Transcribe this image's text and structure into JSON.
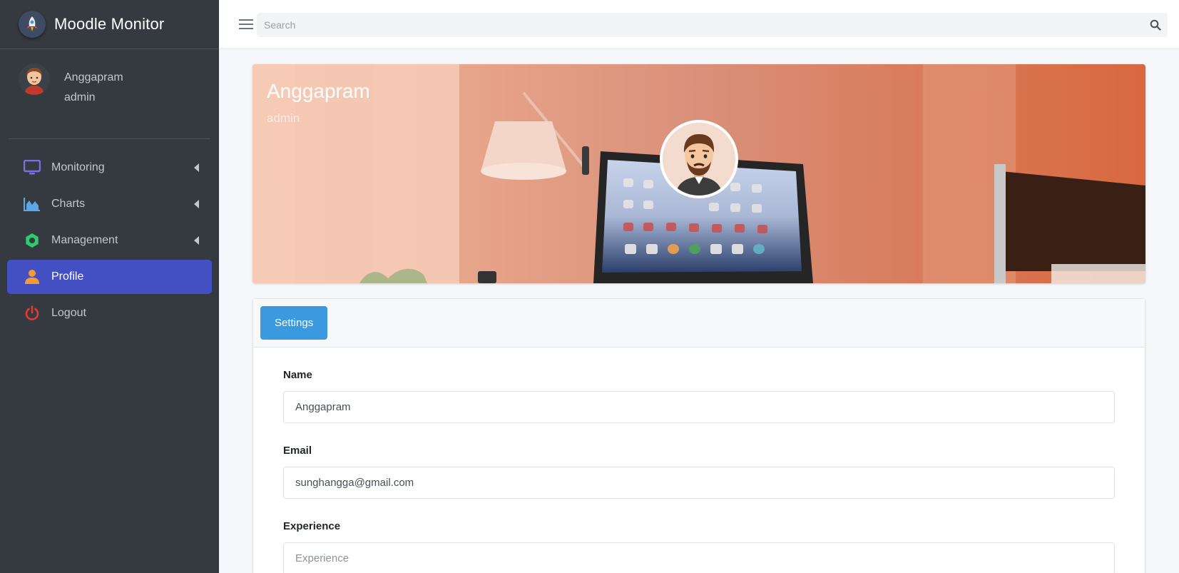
{
  "brand": {
    "name": "Moodle Monitor"
  },
  "user": {
    "name": "Anggapram",
    "role": "admin"
  },
  "nav": {
    "items": [
      {
        "label": "Monitoring"
      },
      {
        "label": "Charts"
      },
      {
        "label": "Management"
      },
      {
        "label": "Profile"
      },
      {
        "label": "Logout"
      }
    ]
  },
  "search": {
    "placeholder": "Search"
  },
  "profile": {
    "name": "Anggapram",
    "role": "admin"
  },
  "tabs": {
    "settings": "Settings"
  },
  "form": {
    "name": {
      "label": "Name",
      "value": "Anggapram"
    },
    "email": {
      "label": "Email",
      "value": "sunghangga@gmail.com"
    },
    "experience": {
      "label": "Experience",
      "placeholder": "Experience"
    }
  },
  "colors": {
    "sidebar_bg": "#343a40",
    "active_nav": "#4350c4",
    "tab_button": "#3b99e0",
    "cover_tint": "#e88a65"
  },
  "icons": {
    "brand": "rocket-icon",
    "monitoring": "monitor-icon",
    "charts": "chart-area-icon",
    "management": "gear-icon",
    "profile": "user-icon",
    "logout": "power-icon",
    "search": "search-icon",
    "menu": "hamburger-icon"
  }
}
